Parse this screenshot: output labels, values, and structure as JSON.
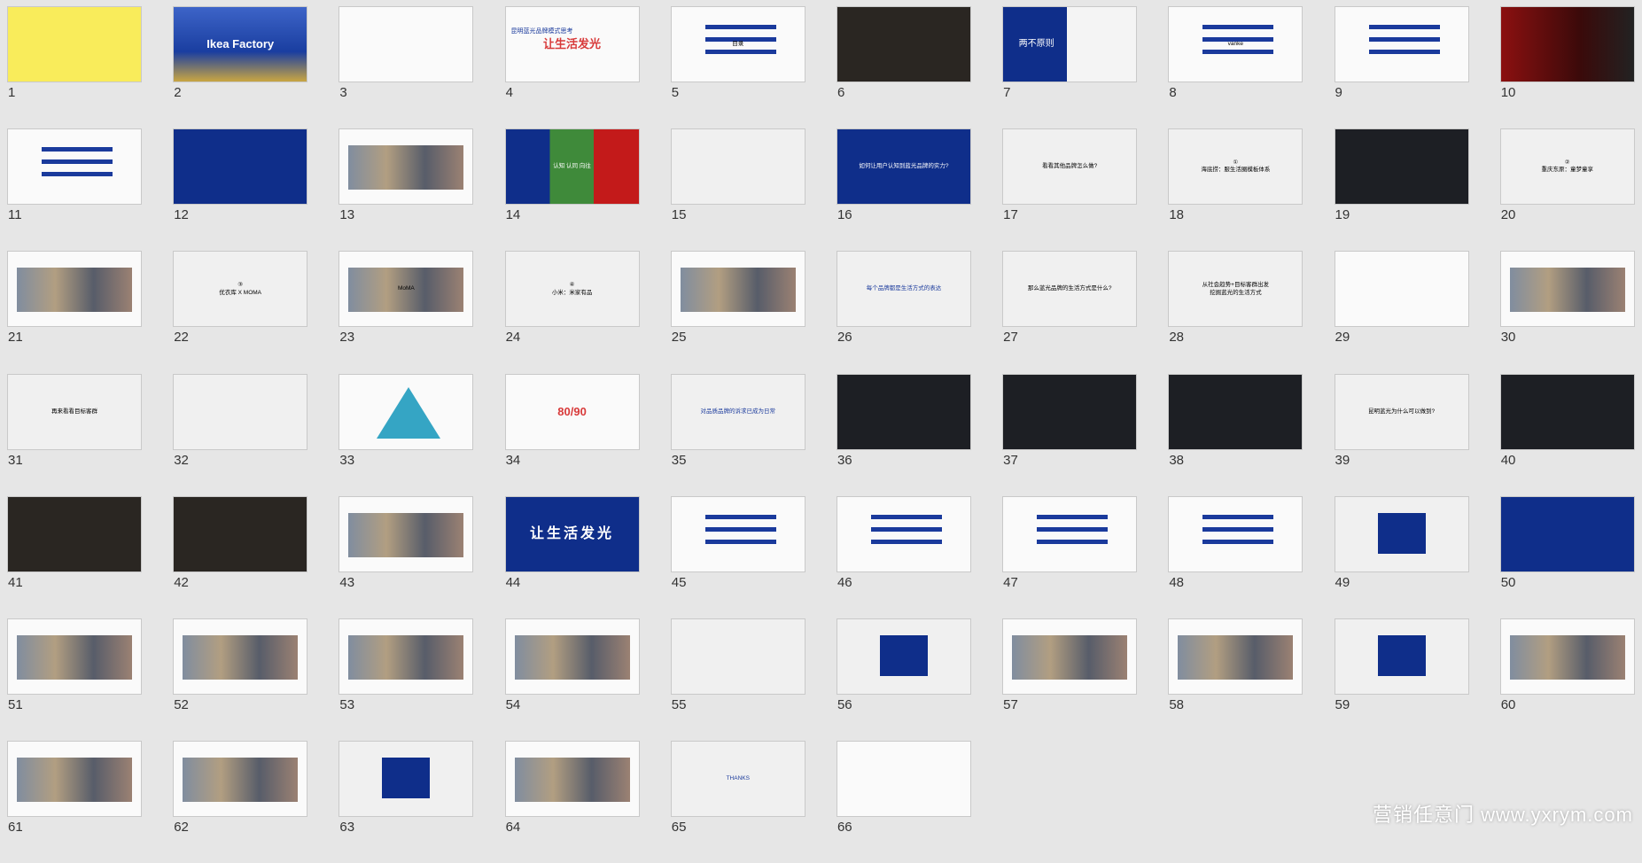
{
  "slides": [
    {
      "n": "1",
      "title": "",
      "style": "yellow"
    },
    {
      "n": "2",
      "title": "Ikea Factory",
      "style": "photo-blue"
    },
    {
      "n": "3",
      "title": "",
      "style": "white"
    },
    {
      "n": "4",
      "title": "让生活发光",
      "sub": "昆明蓝光品牌模式思考",
      "style": "white-red"
    },
    {
      "n": "5",
      "title": "目录",
      "style": "white-list"
    },
    {
      "n": "6",
      "title": "",
      "style": "dark2"
    },
    {
      "n": "7",
      "title": "两不原则",
      "style": "split-blue"
    },
    {
      "n": "8",
      "title": "vanke",
      "style": "white-list"
    },
    {
      "n": "9",
      "title": "",
      "style": "white-list"
    },
    {
      "n": "10",
      "title": "",
      "style": "red-dark"
    },
    {
      "n": "11",
      "title": "",
      "style": "white-list"
    },
    {
      "n": "12",
      "title": "",
      "style": "blue"
    },
    {
      "n": "13",
      "title": "",
      "style": "white-photo"
    },
    {
      "n": "14",
      "title": "认知  认同  向往",
      "style": "tri"
    },
    {
      "n": "15",
      "title": "",
      "style": "grey-text"
    },
    {
      "n": "16",
      "title": "如何让用户认知到蓝光品牌的实力?",
      "style": "blue"
    },
    {
      "n": "17",
      "title": "看看其他品牌怎么做?",
      "style": "grey-text"
    },
    {
      "n": "18",
      "title": "①\n海底捞：服生活圈模板体系",
      "style": "grey-text"
    },
    {
      "n": "19",
      "title": "",
      "style": "dark"
    },
    {
      "n": "20",
      "title": "②\n重庆东原：童梦童享",
      "style": "grey-text"
    },
    {
      "n": "21",
      "title": "",
      "style": "white-photo"
    },
    {
      "n": "22",
      "title": "③\n优衣库 X MOMA",
      "style": "grey-text"
    },
    {
      "n": "23",
      "title": "MoMA",
      "style": "white-photo"
    },
    {
      "n": "24",
      "title": "④\n小米：米家有品",
      "style": "grey-text"
    },
    {
      "n": "25",
      "title": "",
      "style": "white-photo"
    },
    {
      "n": "26",
      "title": "每个品牌都是生活方式的表达",
      "style": "grey-text-blue"
    },
    {
      "n": "27",
      "title": "那么蓝光品牌的生活方式是什么?",
      "style": "grey-text"
    },
    {
      "n": "28",
      "title": "从社会趋势+目标客群出发\n挖掘蓝光的生活方式",
      "style": "grey-text"
    },
    {
      "n": "29",
      "title": "",
      "style": "white-red"
    },
    {
      "n": "30",
      "title": "",
      "style": "white-photo"
    },
    {
      "n": "31",
      "title": "再来看看目标客群",
      "style": "grey-text"
    },
    {
      "n": "32",
      "title": "",
      "style": "grey-text"
    },
    {
      "n": "33",
      "title": "",
      "style": "pyramid"
    },
    {
      "n": "34",
      "title": "80/90",
      "style": "white-red"
    },
    {
      "n": "35",
      "title": "对品质品牌的诉求已成为日常",
      "style": "grey-text-blue"
    },
    {
      "n": "36",
      "title": "",
      "style": "dark"
    },
    {
      "n": "37",
      "title": "",
      "style": "dark"
    },
    {
      "n": "38",
      "title": "",
      "style": "dark"
    },
    {
      "n": "39",
      "title": "昆明蓝光为什么可以做到?",
      "style": "grey-text"
    },
    {
      "n": "40",
      "title": "",
      "style": "dark"
    },
    {
      "n": "41",
      "title": "",
      "style": "dark2"
    },
    {
      "n": "42",
      "title": "",
      "style": "dark2"
    },
    {
      "n": "43",
      "title": "",
      "style": "white-photo"
    },
    {
      "n": "44",
      "title": "让生活发光",
      "style": "blue"
    },
    {
      "n": "45",
      "title": "",
      "style": "white-list"
    },
    {
      "n": "46",
      "title": "",
      "style": "white-list"
    },
    {
      "n": "47",
      "title": "",
      "style": "white-list"
    },
    {
      "n": "48",
      "title": "",
      "style": "white-list"
    },
    {
      "n": "49",
      "title": "",
      "style": "center-blue"
    },
    {
      "n": "50",
      "title": "",
      "style": "blue"
    },
    {
      "n": "51",
      "title": "",
      "style": "white-photo"
    },
    {
      "n": "52",
      "title": "",
      "style": "white-photo"
    },
    {
      "n": "53",
      "title": "",
      "style": "white-photo"
    },
    {
      "n": "54",
      "title": "",
      "style": "white-photo"
    },
    {
      "n": "55",
      "title": "",
      "style": "grey-text"
    },
    {
      "n": "56",
      "title": "",
      "style": "center-blue"
    },
    {
      "n": "57",
      "title": "",
      "style": "white-photo"
    },
    {
      "n": "58",
      "title": "",
      "style": "white-photo"
    },
    {
      "n": "59",
      "title": "",
      "style": "center-blue"
    },
    {
      "n": "60",
      "title": "",
      "style": "white-photo"
    },
    {
      "n": "61",
      "title": "",
      "style": "white-photo"
    },
    {
      "n": "62",
      "title": "",
      "style": "white-photo"
    },
    {
      "n": "63",
      "title": "",
      "style": "center-blue"
    },
    {
      "n": "64",
      "title": "",
      "style": "white-photo"
    },
    {
      "n": "65",
      "title": "THANKS",
      "style": "grey-text-blue"
    },
    {
      "n": "66",
      "title": "",
      "style": "white"
    }
  ],
  "watermark": "营销任意门 www.yxrym.com"
}
